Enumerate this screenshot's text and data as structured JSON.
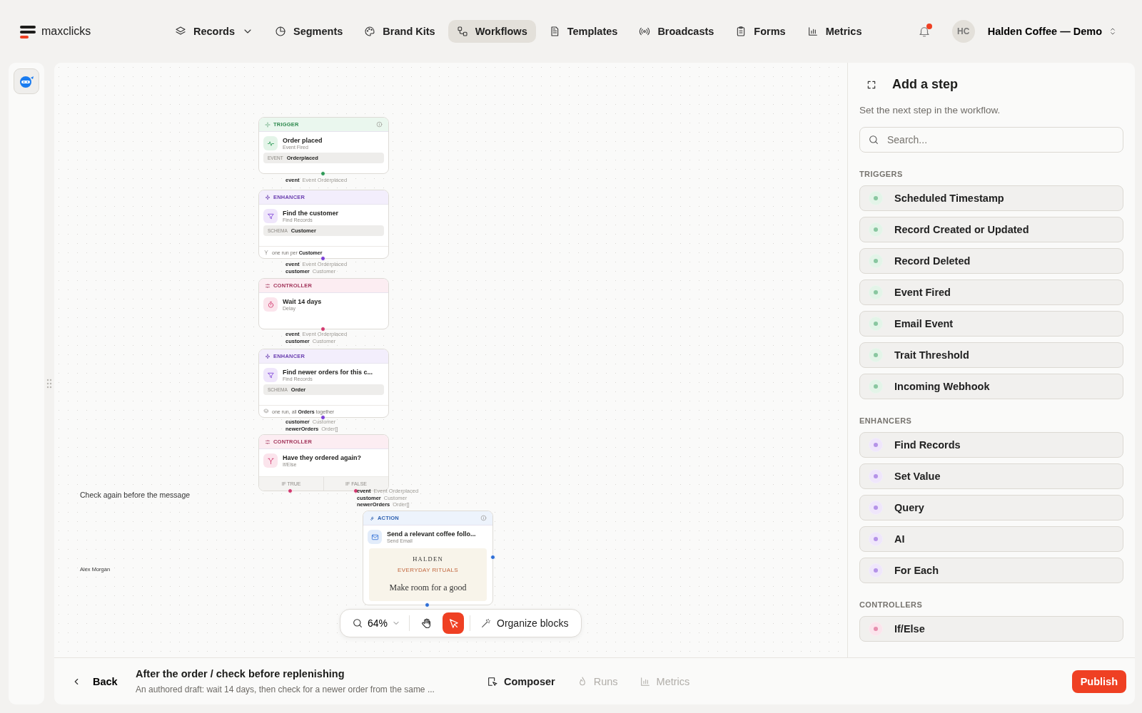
{
  "nav": {
    "logo": "maxclicks",
    "items": [
      {
        "label": "Records",
        "selected": false,
        "dropdown": true
      },
      {
        "label": "Segments",
        "selected": false,
        "dropdown": false
      },
      {
        "label": "Brand Kits",
        "selected": false,
        "dropdown": false
      },
      {
        "label": "Workflows",
        "selected": true,
        "dropdown": false
      },
      {
        "label": "Templates",
        "selected": false,
        "dropdown": false
      },
      {
        "label": "Broadcasts",
        "selected": false,
        "dropdown": false
      },
      {
        "label": "Forms",
        "selected": false,
        "dropdown": false
      },
      {
        "label": "Metrics",
        "selected": false,
        "dropdown": false
      }
    ],
    "notifications": {
      "unread": true
    },
    "account": {
      "initials": "HC",
      "name": "Halden Coffee — Demo"
    }
  },
  "canvas": {
    "nodes": [
      {
        "kind": "trigger",
        "category": "TRIGGER",
        "info": true,
        "title": "Order placed",
        "subtitle": "Event Fired",
        "field": {
          "label": "EVENT",
          "value": "Orderplaced"
        },
        "outputs": [
          {
            "name": "event",
            "type": "Event Orderplaced"
          }
        ]
      },
      {
        "kind": "enhancer",
        "category": "ENHANCER",
        "info": false,
        "title": "Find the customer",
        "subtitle": "Find Records",
        "field": {
          "label": "SCHEMA",
          "value": "Customer"
        },
        "footer": "one run per **Customer**",
        "outputs": [
          {
            "name": "event",
            "type": "Event Orderplaced"
          },
          {
            "name": "customer",
            "type": "Customer"
          }
        ]
      },
      {
        "kind": "controller",
        "category": "CONTROLLER",
        "info": false,
        "title": "Wait 14 days",
        "subtitle": "Delay",
        "outputs": [
          {
            "name": "event",
            "type": "Event Orderplaced"
          },
          {
            "name": "customer",
            "type": "Customer"
          }
        ]
      },
      {
        "kind": "enhancer",
        "category": "ENHANCER",
        "info": false,
        "title": "Find newer orders for this c...",
        "subtitle": "Find Records",
        "field": {
          "label": "SCHEMA",
          "value": "Order"
        },
        "footer": "one run, all **Orders** together",
        "outputs": [
          {
            "name": "customer",
            "type": "Customer"
          },
          {
            "name": "newerOrders",
            "type": "Order[]"
          }
        ]
      },
      {
        "kind": "controller",
        "category": "CONTROLLER",
        "info": false,
        "title": "Have they ordered again?",
        "subtitle": "If/Else",
        "branches": [
          "IF TRUE",
          "IF FALSE"
        ],
        "outputs": [
          {
            "name": "event",
            "type": "Event Orderplaced"
          },
          {
            "name": "customer",
            "type": "Customer"
          },
          {
            "name": "newerOrders",
            "type": "Order[]"
          }
        ]
      },
      {
        "kind": "action",
        "category": "ACTION",
        "info": true,
        "title": "Send a relevant coffee follo...",
        "subtitle": "Send Email",
        "preview": {
          "brand": "HALDEN",
          "tagline": "EVERYDAY RITUALS",
          "headline": "Make room for a good"
        }
      }
    ],
    "notes": [
      {
        "kind": "note",
        "text": "Check again before the message"
      },
      {
        "kind": "author",
        "text": "Alex Morgan"
      }
    ],
    "toolbar": {
      "zoom": "64%",
      "tools": [
        {
          "kind": "hand",
          "selected": false
        },
        {
          "kind": "pointer",
          "selected": true
        }
      ],
      "action": "Organize blocks"
    }
  },
  "panel": {
    "title": "Add a step",
    "subtitle": "Set the next step in the workflow.",
    "search": {
      "placeholder": "Search..."
    },
    "sections": [
      {
        "kind": "trigger",
        "heading": "TRIGGERS",
        "items": [
          "Scheduled Timestamp",
          "Record Created or Updated",
          "Record Deleted",
          "Event Fired",
          "Email Event",
          "Trait Threshold",
          "Incoming Webhook"
        ]
      },
      {
        "kind": "enhancer",
        "heading": "ENHANCERS",
        "items": [
          "Find Records",
          "Set Value",
          "Query",
          "AI",
          "For Each"
        ]
      },
      {
        "kind": "controller",
        "heading": "CONTROLLERS",
        "items": [
          "If/Else"
        ]
      }
    ]
  },
  "footer": {
    "back": "Back",
    "title": "After the order / check before replenishing",
    "description": "An authored draft: wait 14 days, then check for a newer order from the same ...",
    "tabs": [
      {
        "label": "Composer",
        "selected": true
      },
      {
        "label": "Runs",
        "selected": false
      },
      {
        "label": "Metrics",
        "selected": false
      }
    ],
    "publish": "Publish"
  }
}
